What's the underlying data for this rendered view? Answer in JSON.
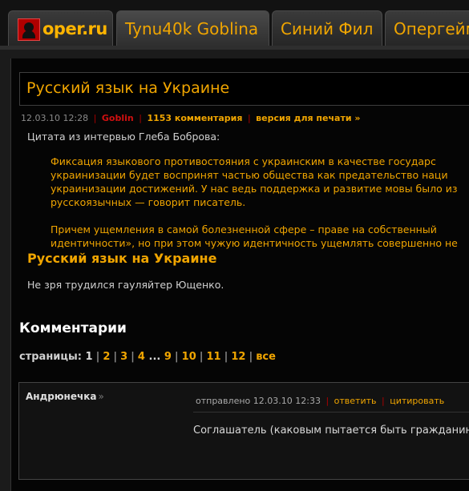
{
  "nav": {
    "logo_text": "oper.ru",
    "tabs": [
      "Tynu40k Goblina",
      "Синий Фил",
      "Опергейм"
    ]
  },
  "article": {
    "title": "Русский язык на Украине",
    "date": "12.03.10 12:28",
    "author": "Goblin",
    "comments_link": "1153 комментария",
    "print_link": "версия для печати »",
    "intro": "Цитата из интервью Глеба Боброва:",
    "quote": [
      "Фиксация языкового противостояния с украинским в качестве государс",
      "украинизации будет воспринят частью общества как предательство наци",
      "украинизации достижений. У нас ведь поддержка и развитие мовы было из",
      "русскоязычных — говорит писатель.",
      "Причем ущемления в самой болезненной сфере – праве на собственный",
      "идентичности», но при этом чужую идентичность ущемлять совершенно не"
    ],
    "subtitle": "Русский язык на Украине",
    "note": "Не зря трудился гауляйтер Ющенко."
  },
  "comments": {
    "heading": "Комментарии",
    "pages_label": "страницы:",
    "pages": [
      "1",
      "2",
      "3",
      "4",
      "...",
      "9",
      "10",
      "11",
      "12",
      "все"
    ],
    "current_page": "1",
    "items": [
      {
        "author": "Андрюнечка",
        "author_suffix": "»",
        "sent_label": "отправлено",
        "sent_at": "12.03.10 12:33",
        "reply": "ответить",
        "quote": "цитировать",
        "text": "Соглашатель (каковым пытается быть гражданин"
      }
    ]
  },
  "colors": {
    "accent": "#f0a500",
    "author_red": "#d01010",
    "separator_red": "#b00000",
    "background": "#050505"
  }
}
